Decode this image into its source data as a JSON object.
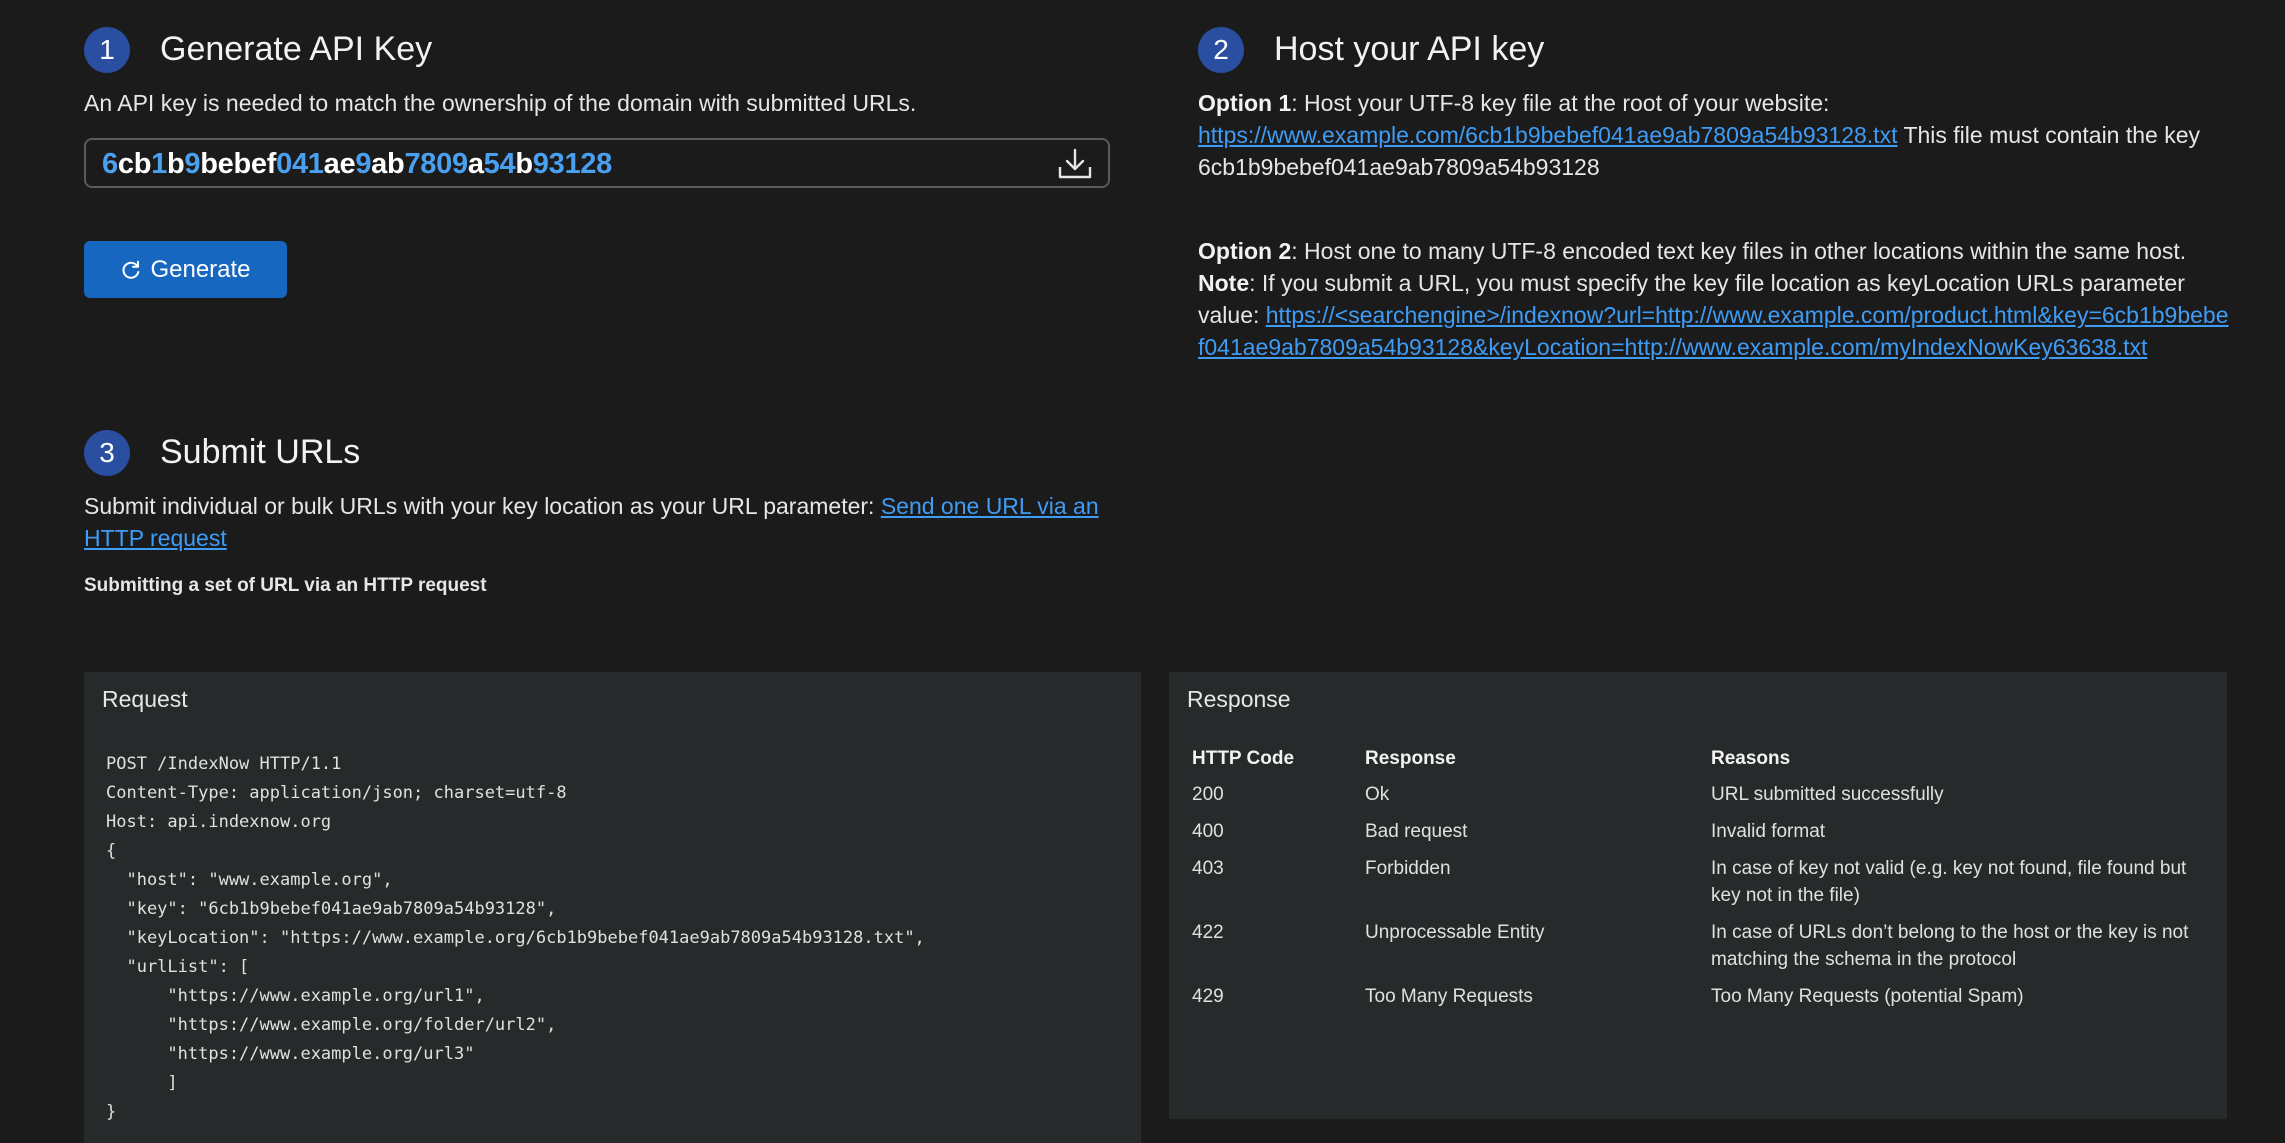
{
  "step1": {
    "number": "1",
    "title": "Generate API Key",
    "description": "An API key is needed to match the ownership of the domain with submitted URLs.",
    "api_key": "6cb1b9bebef041ae9ab7809a54b93128",
    "generate_label": "Generate"
  },
  "step2": {
    "number": "2",
    "title": "Host your API key",
    "option1_label": "Option 1",
    "option1_text": ": Host your UTF-8 key file at the root of your website:",
    "option1_link": "https://www.example.com/6cb1b9bebef041ae9ab7809a54b93128.txt",
    "option1_after": " This file must contain the key 6cb1b9bebef041ae9ab7809a54b93128",
    "option2_label": "Option 2",
    "option2_text": ": Host one to many UTF-8 encoded text key files in other locations within the same host.",
    "note_label": "Note",
    "note_text": ": If you submit a URL, you must specify the key file location as keyLocation URLs parameter value: ",
    "note_link": "https://<searchengine>/indexnow?url=http://www.example.com/product.html&key=6cb1b9bebef041ae9ab7809a54b93128&keyLocation=http://www.example.com/myIndexNowKey63638.txt"
  },
  "step3": {
    "number": "3",
    "title": "Submit URLs",
    "description": "Submit individual or bulk URLs with your key location as your URL parameter: ",
    "link": "Send one URL via an HTTP request",
    "subheading": "Submitting a set of URL via an HTTP request"
  },
  "request": {
    "title": "Request",
    "code": "POST /IndexNow HTTP/1.1\nContent-Type: application/json; charset=utf-8\nHost: api.indexnow.org\n{\n  \"host\": \"www.example.org\",\n  \"key\": \"6cb1b9bebef041ae9ab7809a54b93128\",\n  \"keyLocation\": \"https://www.example.org/6cb1b9bebef041ae9ab7809a54b93128.txt\",\n  \"urlList\": [\n      \"https://www.example.org/url1\",\n      \"https://www.example.org/folder/url2\",\n      \"https://www.example.org/url3\"\n      ]\n}"
  },
  "response": {
    "title": "Response",
    "headers": [
      "HTTP Code",
      "Response",
      "Reasons"
    ],
    "rows": [
      [
        "200",
        "Ok",
        "URL submitted successfully"
      ],
      [
        "400",
        "Bad request",
        "Invalid format"
      ],
      [
        "403",
        "Forbidden",
        "In case of key not valid (e.g. key not found, file found but key not in the file)"
      ],
      [
        "422",
        "Unprocessable Entity",
        "In case of URLs don’t belong to the host or the key is not matching the schema in the protocol"
      ],
      [
        "429",
        "Too Many Requests",
        "Too Many Requests (potential Spam)"
      ]
    ]
  },
  "icons": {
    "download": "download-icon",
    "refresh": "refresh-icon"
  },
  "colors": {
    "background": "#1b1b1c",
    "accent": "#1766c0",
    "badge": "#2a4fa0",
    "link": "#3f9cf5",
    "key_digit": "#4aa0f0",
    "panel": "#272a2b"
  }
}
